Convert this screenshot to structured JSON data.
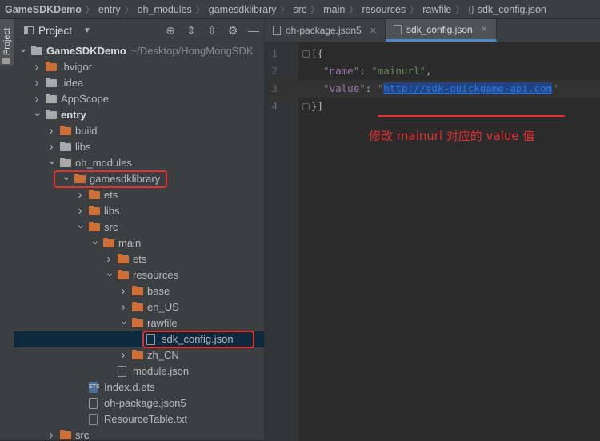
{
  "breadcrumb": {
    "items": [
      "GameSDKDemo",
      "entry",
      "oh_modules",
      "gamesdklibrary",
      "src",
      "main",
      "resources",
      "rawfile",
      "sdk_config.json"
    ]
  },
  "tool_strip": {
    "tab_label": "Project"
  },
  "project_panel": {
    "title": "Project",
    "tree": [
      {
        "label": "GameSDKDemo",
        "sub": "~/Desktop/HongMongSDK",
        "depth": 0,
        "arrow": "open",
        "icon": "folder-gray",
        "bold": true
      },
      {
        "label": ".hvigor",
        "depth": 1,
        "arrow": "closed",
        "icon": "folder-orange"
      },
      {
        "label": ".idea",
        "depth": 1,
        "arrow": "closed",
        "icon": "folder-gray"
      },
      {
        "label": "AppScope",
        "depth": 1,
        "arrow": "closed",
        "icon": "folder-gray"
      },
      {
        "label": "entry",
        "depth": 1,
        "arrow": "open",
        "icon": "folder-gray",
        "bold": true
      },
      {
        "label": "build",
        "depth": 2,
        "arrow": "closed",
        "icon": "folder-orange"
      },
      {
        "label": "libs",
        "depth": 2,
        "arrow": "closed",
        "icon": "folder-gray"
      },
      {
        "label": "oh_modules",
        "depth": 2,
        "arrow": "open",
        "icon": "folder-gray"
      },
      {
        "label": "gamesdklibrary",
        "depth": 3,
        "arrow": "open",
        "icon": "folder-orange",
        "boxed": true
      },
      {
        "label": "ets",
        "depth": 4,
        "arrow": "closed",
        "icon": "folder-orange"
      },
      {
        "label": "libs",
        "depth": 4,
        "arrow": "closed",
        "icon": "folder-orange"
      },
      {
        "label": "src",
        "depth": 4,
        "arrow": "open",
        "icon": "folder-orange"
      },
      {
        "label": "main",
        "depth": 5,
        "arrow": "open",
        "icon": "folder-orange"
      },
      {
        "label": "ets",
        "depth": 6,
        "arrow": "closed",
        "icon": "folder-orange"
      },
      {
        "label": "resources",
        "depth": 6,
        "arrow": "open",
        "icon": "folder-orange"
      },
      {
        "label": "base",
        "depth": 7,
        "arrow": "closed",
        "icon": "folder-orange"
      },
      {
        "label": "en_US",
        "depth": 7,
        "arrow": "closed",
        "icon": "folder-orange"
      },
      {
        "label": "rawfile",
        "depth": 7,
        "arrow": "open",
        "icon": "folder-orange"
      },
      {
        "label": "sdk_config.json",
        "depth": 8,
        "arrow": "none",
        "icon": "file-json",
        "selected": true,
        "boxed": true
      },
      {
        "label": "zh_CN",
        "depth": 7,
        "arrow": "closed",
        "icon": "folder-orange"
      },
      {
        "label": "module.json",
        "depth": 6,
        "arrow": "none",
        "icon": "file-json"
      },
      {
        "label": "Index.d.ets",
        "depth": 4,
        "arrow": "none",
        "icon": "file-ets"
      },
      {
        "label": "oh-package.json5",
        "depth": 4,
        "arrow": "none",
        "icon": "file-json"
      },
      {
        "label": "ResourceTable.txt",
        "depth": 4,
        "arrow": "none",
        "icon": "file-txt"
      },
      {
        "label": "src",
        "depth": 2,
        "arrow": "closed",
        "icon": "folder-orange"
      }
    ]
  },
  "editor": {
    "tabs": [
      {
        "label": "oh-package.json5",
        "active": false
      },
      {
        "label": "sdk_config.json",
        "active": true
      }
    ],
    "lines": [
      {
        "num": "1",
        "parts": [
          {
            "t": "[{",
            "c": "p"
          }
        ]
      },
      {
        "num": "2",
        "parts": [
          {
            "t": "  ",
            "c": "p"
          },
          {
            "t": "\"name\"",
            "c": "k"
          },
          {
            "t": ": ",
            "c": "p"
          },
          {
            "t": "\"mainurl\"",
            "c": "s"
          },
          {
            "t": ",",
            "c": "p"
          }
        ]
      },
      {
        "num": "3",
        "parts": [
          {
            "t": "  ",
            "c": "p"
          },
          {
            "t": "\"value\"",
            "c": "k"
          },
          {
            "t": ": ",
            "c": "p"
          },
          {
            "t": "\"",
            "c": "s"
          },
          {
            "t": "http://sdk-quickgame-api.com",
            "c": "url"
          },
          {
            "t": "\"",
            "c": "s"
          }
        ]
      },
      {
        "num": "4",
        "parts": [
          {
            "t": "}]",
            "c": "p"
          }
        ]
      }
    ],
    "annotation": "修改 mainurl 对应的 value 值"
  },
  "colors": {
    "accent_red": "#e62e2e",
    "folder_orange": "#cf6f38",
    "selection": "#0d293e"
  }
}
